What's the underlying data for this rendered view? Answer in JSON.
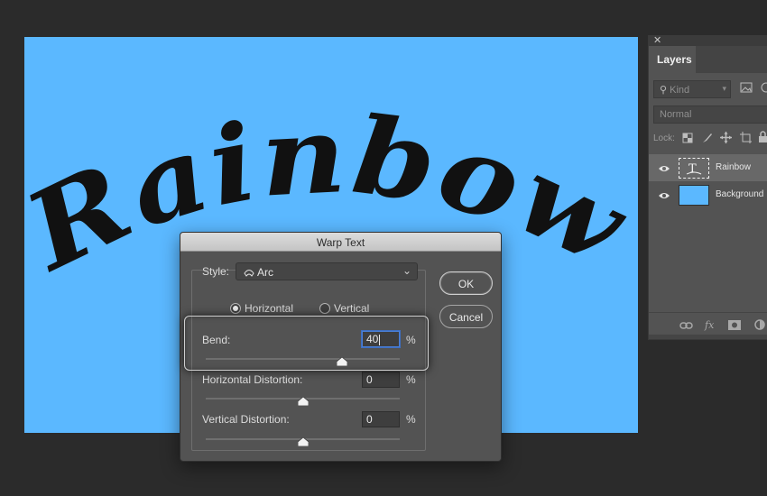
{
  "canvas": {
    "text": "Rainbow",
    "background": "#5bb8ff"
  },
  "layers_panel": {
    "close_glyph": "✕",
    "tab": "Layers",
    "filter_placeholder": "Kind",
    "blend_mode": "Normal",
    "lock_label": "Lock:",
    "layers": [
      {
        "name": "Rainbow",
        "type": "text",
        "selected": true
      },
      {
        "name": "Background",
        "type": "fill",
        "selected": false
      }
    ],
    "fx_label": "fx"
  },
  "dialog": {
    "title": "Warp Text",
    "style_label": "Style:",
    "style_value": "Arc",
    "orientation": {
      "horizontal": "Horizontal",
      "vertical": "Vertical",
      "selected": "Horizontal"
    },
    "bend": {
      "label": "Bend:",
      "value": "40",
      "unit": "%",
      "percent": 40
    },
    "horizontal_distortion": {
      "label": "Horizontal Distortion:",
      "value": "0",
      "unit": "%",
      "percent": 0
    },
    "vertical_distortion": {
      "label": "Vertical Distortion:",
      "value": "0",
      "unit": "%",
      "percent": 0
    },
    "ok": "OK",
    "cancel": "Cancel"
  }
}
